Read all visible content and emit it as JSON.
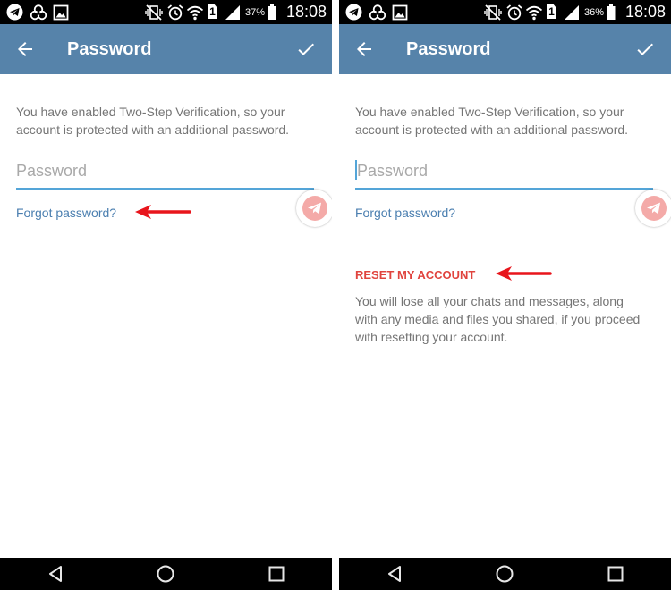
{
  "panels": [
    {
      "status_bar": {
        "sim": "1",
        "battery": "37%",
        "time": "18:08"
      },
      "app_bar": {
        "title": "Password"
      },
      "intro_lines": [
        "You have enabled Two-Step Verification, so your",
        "account is protected with an additional password."
      ],
      "password_field": {
        "placeholder": "Password"
      },
      "forgot_link": "Forgot password?"
    },
    {
      "status_bar": {
        "sim": "1",
        "battery": "36%",
        "time": "18:08"
      },
      "app_bar": {
        "title": "Password"
      },
      "intro_lines": [
        "You have enabled Two-Step Verification, so your",
        "account is protected with an additional password."
      ],
      "password_field": {
        "placeholder": "Password"
      },
      "forgot_link": "Forgot password?",
      "reset": {
        "label": "RESET MY ACCOUNT",
        "warning_lines": [
          "You will lose all your chats and messages, along",
          "with any media and files you shared, if you proceed",
          "with resetting your account."
        ]
      }
    }
  ],
  "colors": {
    "app_bar": "#5683aa",
    "link": "#4b7fb0",
    "reset": "#e0443e",
    "annotation_arrow": "#e8151c",
    "field_underline": "#54a5d8",
    "fab_inner": "#f4aaa8"
  },
  "icons": {
    "status_left": [
      "telegram-icon",
      "biohazard-icon",
      "gallery-icon"
    ],
    "status_right": [
      "vibrate-off-icon",
      "alarm-icon",
      "wifi-icon",
      "sim-icon",
      "signal-icon",
      "battery-icon"
    ],
    "app_bar": [
      "back-arrow-icon",
      "checkmark-icon"
    ],
    "fab": "telegram-plane-icon",
    "nav": [
      "nav-back-icon",
      "nav-home-icon",
      "nav-recents-icon"
    ]
  }
}
